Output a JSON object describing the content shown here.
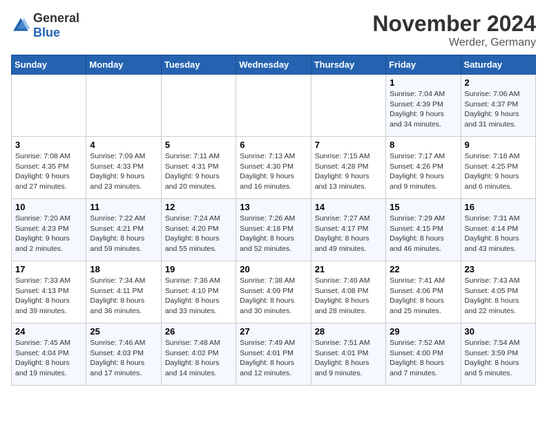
{
  "header": {
    "logo_general": "General",
    "logo_blue": "Blue",
    "month_title": "November 2024",
    "location": "Werder, Germany"
  },
  "days_of_week": [
    "Sunday",
    "Monday",
    "Tuesday",
    "Wednesday",
    "Thursday",
    "Friday",
    "Saturday"
  ],
  "weeks": [
    [
      null,
      null,
      null,
      null,
      null,
      {
        "day": "1",
        "sunrise": "Sunrise: 7:04 AM",
        "sunset": "Sunset: 4:39 PM",
        "daylight": "Daylight: 9 hours and 34 minutes."
      },
      {
        "day": "2",
        "sunrise": "Sunrise: 7:06 AM",
        "sunset": "Sunset: 4:37 PM",
        "daylight": "Daylight: 9 hours and 31 minutes."
      }
    ],
    [
      {
        "day": "3",
        "sunrise": "Sunrise: 7:08 AM",
        "sunset": "Sunset: 4:35 PM",
        "daylight": "Daylight: 9 hours and 27 minutes."
      },
      {
        "day": "4",
        "sunrise": "Sunrise: 7:09 AM",
        "sunset": "Sunset: 4:33 PM",
        "daylight": "Daylight: 9 hours and 23 minutes."
      },
      {
        "day": "5",
        "sunrise": "Sunrise: 7:11 AM",
        "sunset": "Sunset: 4:31 PM",
        "daylight": "Daylight: 9 hours and 20 minutes."
      },
      {
        "day": "6",
        "sunrise": "Sunrise: 7:13 AM",
        "sunset": "Sunset: 4:30 PM",
        "daylight": "Daylight: 9 hours and 16 minutes."
      },
      {
        "day": "7",
        "sunrise": "Sunrise: 7:15 AM",
        "sunset": "Sunset: 4:28 PM",
        "daylight": "Daylight: 9 hours and 13 minutes."
      },
      {
        "day": "8",
        "sunrise": "Sunrise: 7:17 AM",
        "sunset": "Sunset: 4:26 PM",
        "daylight": "Daylight: 9 hours and 9 minutes."
      },
      {
        "day": "9",
        "sunrise": "Sunrise: 7:18 AM",
        "sunset": "Sunset: 4:25 PM",
        "daylight": "Daylight: 9 hours and 6 minutes."
      }
    ],
    [
      {
        "day": "10",
        "sunrise": "Sunrise: 7:20 AM",
        "sunset": "Sunset: 4:23 PM",
        "daylight": "Daylight: 9 hours and 2 minutes."
      },
      {
        "day": "11",
        "sunrise": "Sunrise: 7:22 AM",
        "sunset": "Sunset: 4:21 PM",
        "daylight": "Daylight: 8 hours and 59 minutes."
      },
      {
        "day": "12",
        "sunrise": "Sunrise: 7:24 AM",
        "sunset": "Sunset: 4:20 PM",
        "daylight": "Daylight: 8 hours and 55 minutes."
      },
      {
        "day": "13",
        "sunrise": "Sunrise: 7:26 AM",
        "sunset": "Sunset: 4:18 PM",
        "daylight": "Daylight: 8 hours and 52 minutes."
      },
      {
        "day": "14",
        "sunrise": "Sunrise: 7:27 AM",
        "sunset": "Sunset: 4:17 PM",
        "daylight": "Daylight: 8 hours and 49 minutes."
      },
      {
        "day": "15",
        "sunrise": "Sunrise: 7:29 AM",
        "sunset": "Sunset: 4:15 PM",
        "daylight": "Daylight: 8 hours and 46 minutes."
      },
      {
        "day": "16",
        "sunrise": "Sunrise: 7:31 AM",
        "sunset": "Sunset: 4:14 PM",
        "daylight": "Daylight: 8 hours and 43 minutes."
      }
    ],
    [
      {
        "day": "17",
        "sunrise": "Sunrise: 7:33 AM",
        "sunset": "Sunset: 4:13 PM",
        "daylight": "Daylight: 8 hours and 39 minutes."
      },
      {
        "day": "18",
        "sunrise": "Sunrise: 7:34 AM",
        "sunset": "Sunset: 4:11 PM",
        "daylight": "Daylight: 8 hours and 36 minutes."
      },
      {
        "day": "19",
        "sunrise": "Sunrise: 7:36 AM",
        "sunset": "Sunset: 4:10 PM",
        "daylight": "Daylight: 8 hours and 33 minutes."
      },
      {
        "day": "20",
        "sunrise": "Sunrise: 7:38 AM",
        "sunset": "Sunset: 4:09 PM",
        "daylight": "Daylight: 8 hours and 30 minutes."
      },
      {
        "day": "21",
        "sunrise": "Sunrise: 7:40 AM",
        "sunset": "Sunset: 4:08 PM",
        "daylight": "Daylight: 8 hours and 28 minutes."
      },
      {
        "day": "22",
        "sunrise": "Sunrise: 7:41 AM",
        "sunset": "Sunset: 4:06 PM",
        "daylight": "Daylight: 8 hours and 25 minutes."
      },
      {
        "day": "23",
        "sunrise": "Sunrise: 7:43 AM",
        "sunset": "Sunset: 4:05 PM",
        "daylight": "Daylight: 8 hours and 22 minutes."
      }
    ],
    [
      {
        "day": "24",
        "sunrise": "Sunrise: 7:45 AM",
        "sunset": "Sunset: 4:04 PM",
        "daylight": "Daylight: 8 hours and 19 minutes."
      },
      {
        "day": "25",
        "sunrise": "Sunrise: 7:46 AM",
        "sunset": "Sunset: 4:03 PM",
        "daylight": "Daylight: 8 hours and 17 minutes."
      },
      {
        "day": "26",
        "sunrise": "Sunrise: 7:48 AM",
        "sunset": "Sunset: 4:02 PM",
        "daylight": "Daylight: 8 hours and 14 minutes."
      },
      {
        "day": "27",
        "sunrise": "Sunrise: 7:49 AM",
        "sunset": "Sunset: 4:01 PM",
        "daylight": "Daylight: 8 hours and 12 minutes."
      },
      {
        "day": "28",
        "sunrise": "Sunrise: 7:51 AM",
        "sunset": "Sunset: 4:01 PM",
        "daylight": "Daylight: 8 hours and 9 minutes."
      },
      {
        "day": "29",
        "sunrise": "Sunrise: 7:52 AM",
        "sunset": "Sunset: 4:00 PM",
        "daylight": "Daylight: 8 hours and 7 minutes."
      },
      {
        "day": "30",
        "sunrise": "Sunrise: 7:54 AM",
        "sunset": "Sunset: 3:59 PM",
        "daylight": "Daylight: 8 hours and 5 minutes."
      }
    ]
  ]
}
